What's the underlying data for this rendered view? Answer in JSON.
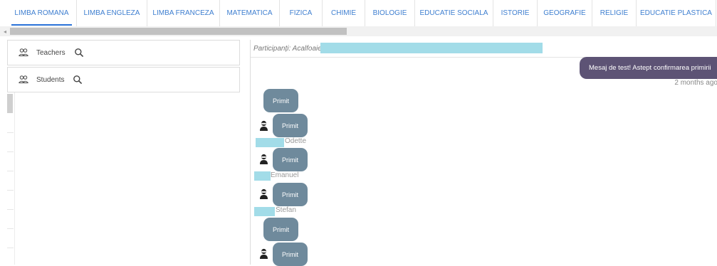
{
  "tabs": [
    {
      "label": "LIMBA ROMANA",
      "active": true
    },
    {
      "label": "LIMBA ENGLEZA"
    },
    {
      "label": "LIMBA FRANCEZA"
    },
    {
      "label": "MATEMATICA"
    },
    {
      "label": "FIZICA"
    },
    {
      "label": "CHIMIE"
    },
    {
      "label": "BIOLOGIE"
    },
    {
      "label": "EDUCATIE SOCIALA"
    },
    {
      "label": "ISTORIE"
    },
    {
      "label": "GEOGRAFIE"
    },
    {
      "label": "RELIGIE"
    },
    {
      "label": "EDUCATIE PLASTICA"
    }
  ],
  "scroll_arrow": "◂",
  "sidebar": {
    "teachers_label": "Teachers",
    "students_label": "Students"
  },
  "chat": {
    "participants_label": "Participanți: Acalfoaie,",
    "sent_message": "Mesaj de test! Astept confirmarea primirii",
    "sent_time": "2 months ago",
    "replies": [
      {
        "text": "Primit",
        "sender": ""
      },
      {
        "text": "Primit",
        "sender": "Odette"
      },
      {
        "text": "Primit",
        "sender": "Emanuel"
      },
      {
        "text": "Primit",
        "sender": "Stefan"
      },
      {
        "text": "Primit",
        "sender": ""
      },
      {
        "text": "Primit",
        "sender": ""
      }
    ]
  },
  "colors": {
    "tab_text": "#3f7fd0",
    "outgoing_bubble": "#5d5375",
    "incoming_bubble": "#6f8a9c",
    "redaction": "#a2dce8"
  }
}
